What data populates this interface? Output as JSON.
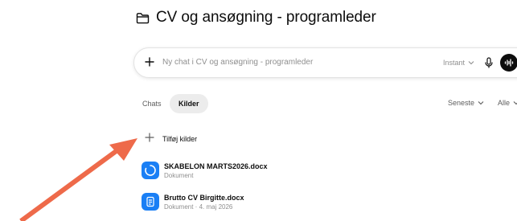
{
  "project": {
    "title": "CV og ansøgning - programleder",
    "title_icon": "folder-icon"
  },
  "composer": {
    "placeholder": "Ny chat i CV og ansøgning - programleder",
    "model_label": "Instant",
    "icons": [
      "plus-icon",
      "chevron-down-icon",
      "microphone-icon",
      "voice-mode-icon"
    ]
  },
  "tabs": [
    {
      "label": "Chats",
      "selected": false
    },
    {
      "label": "Kilder",
      "selected": true
    }
  ],
  "filters": {
    "sort_label": "Seneste",
    "type_label": "Alle"
  },
  "sources": {
    "add_label": "Tilføj kilder",
    "files": [
      {
        "name": "SKABELON MARTS2026.docx",
        "subtitle": "Dokument",
        "icon": "loading-spinner-icon"
      },
      {
        "name": "Brutto CV Birgitte.docx",
        "subtitle": "Dokument · 4. maj 2026",
        "icon": "document-icon"
      }
    ]
  },
  "annotation": {
    "arrow_color": "#ee6a4a"
  },
  "colors": {
    "file_icon_blue": "#1a7ff5",
    "text_primary": "#0d0d0d",
    "text_muted": "#8f8f8f"
  }
}
